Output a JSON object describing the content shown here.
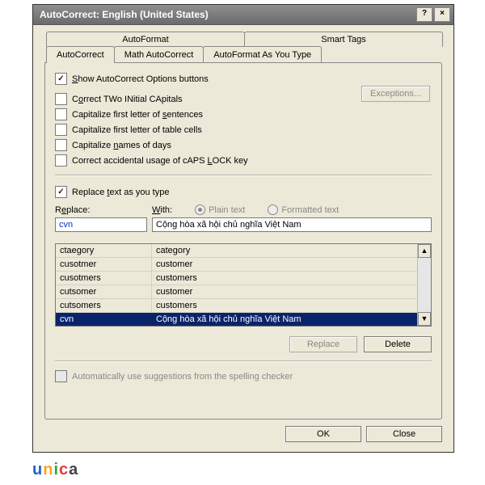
{
  "window": {
    "title": "AutoCorrect: English (United States)"
  },
  "tabs_back": [
    {
      "label": "AutoFormat"
    },
    {
      "label": "Smart Tags"
    }
  ],
  "tabs_front": [
    {
      "label": "AutoCorrect"
    },
    {
      "label": "Math AutoCorrect"
    },
    {
      "label": "AutoFormat As You Type"
    }
  ],
  "options": {
    "show_buttons": "Show AutoCorrect Options buttons",
    "two_caps": "Correct TWo INitial CApitals",
    "first_sentence": "Capitalize first letter of sentences",
    "first_table": "Capitalize first letter of table cells",
    "names_days": "Capitalize names of days",
    "caps_lock": "Correct accidental usage of cAPS LOCK key",
    "replace_as_type": "Replace text as you type"
  },
  "labels": {
    "replace": "Replace:",
    "with": "With:",
    "plain": "Plain text",
    "formatted": "Formatted text",
    "exceptions": "Exceptions...",
    "replace_btn": "Replace",
    "delete_btn": "Delete",
    "auto_suggest": "Automatically use suggestions from the spelling checker",
    "ok": "OK",
    "close": "Close"
  },
  "fields": {
    "replace_value": "cvn",
    "with_value": "Cộng hòa xã hội chủ nghĩa Việt Nam"
  },
  "list": [
    {
      "r": "ctaegory",
      "w": "category"
    },
    {
      "r": "cusotmer",
      "w": "customer"
    },
    {
      "r": "cusotmers",
      "w": "customers"
    },
    {
      "r": "cutsomer",
      "w": "customer"
    },
    {
      "r": "cutsomers",
      "w": "customers"
    },
    {
      "r": "cvn",
      "w": "Cộng hòa xã hội chủ nghĩa Việt Nam",
      "selected": true
    }
  ],
  "logo": {
    "u": "u",
    "n": "n",
    "i": "i",
    "c": "c",
    "a": "a"
  }
}
